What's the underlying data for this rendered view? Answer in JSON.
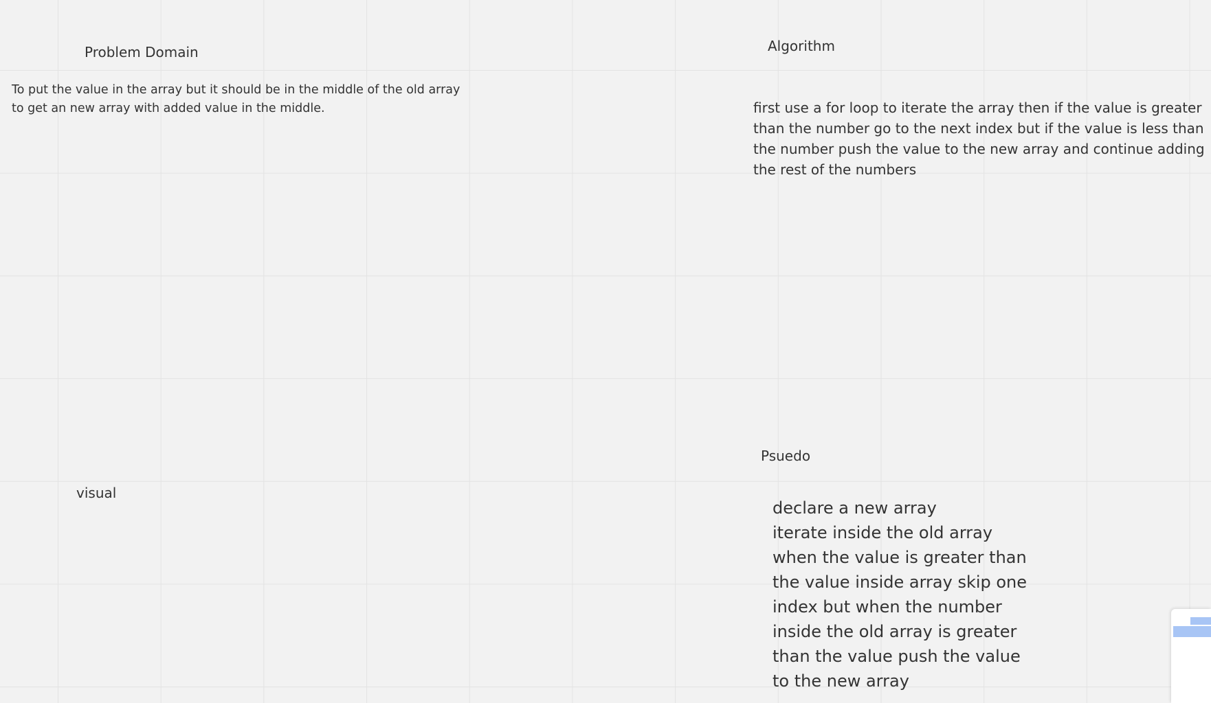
{
  "board": {
    "problem_domain": {
      "title": "Problem Domain",
      "body_lines": [
        "To put the value in the array but it should be in the middle of the old array",
        "to get an new array with added value in the middle."
      ]
    },
    "algorithm": {
      "title": "Algorithm",
      "body_lines": [
        "first use a  for loop to iterate the array then if the value is greater",
        "than the number go to the next index but if the value is less than",
        "the number push the value to the new array and continue adding",
        "the rest of the numbers"
      ]
    },
    "pseudo": {
      "title_before": "Psued",
      "title_mark": "",
      "title_after": "o",
      "body_lines": [
        "declare a new array",
        "iterate inside the old array",
        "when the value is greater than",
        "the value inside array skip one",
        "index but when the number",
        "inside the old array is greater",
        "than the value push the value",
        "to the new array"
      ]
    },
    "visual": {
      "title": "visual"
    }
  },
  "colors": {
    "background": "#f2f2f2",
    "grid_line": "#e3e3e3",
    "text": "#333333",
    "minimap_highlight": "#a8c5f5"
  },
  "icons": {
    "minimap": "minimap-panel"
  }
}
